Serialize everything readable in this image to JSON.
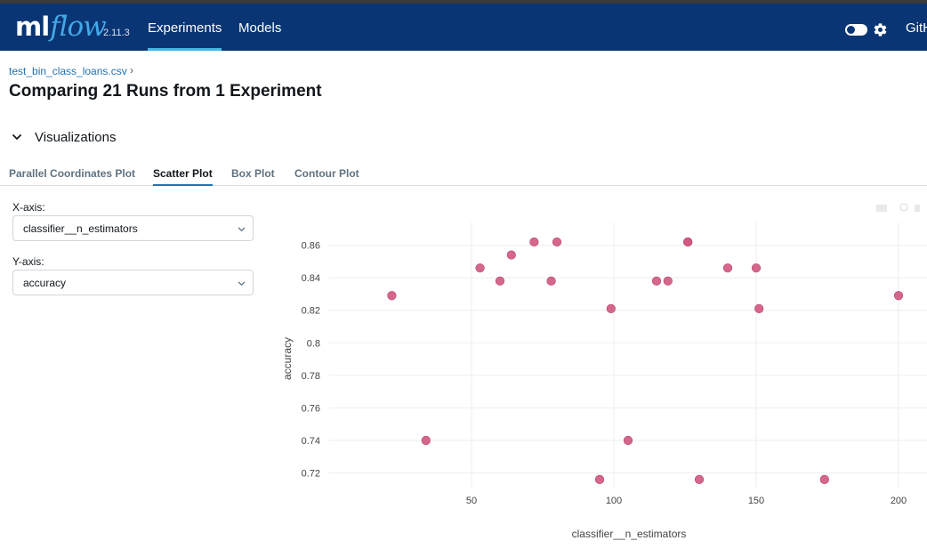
{
  "app": {
    "logo_primary": "ml",
    "logo_secondary": "flow",
    "version": "2.11.3"
  },
  "nav": {
    "items": [
      {
        "label": "Experiments",
        "active": true
      },
      {
        "label": "Models",
        "active": false
      }
    ],
    "github_label": "GitHub"
  },
  "page": {
    "breadcrumb": "test_bin_class_loans.csv",
    "breadcrumb_separator": "›",
    "title": "Comparing 21 Runs from 1 Experiment"
  },
  "visualizations": {
    "section_title": "Visualizations",
    "tabs": [
      {
        "label": "Parallel Coordinates Plot",
        "active": false
      },
      {
        "label": "Scatter Plot",
        "active": true
      },
      {
        "label": "Box Plot",
        "active": false
      },
      {
        "label": "Contour Plot",
        "active": false
      }
    ],
    "x_axis_label": "X-axis:",
    "x_axis_value": "classifier__n_estimators",
    "y_axis_label": "Y-axis:",
    "y_axis_value": "accuracy"
  },
  "colors": {
    "nav_bg": "#0a3574",
    "accent": "#2272b4",
    "point": "#d0577f"
  },
  "icons": [
    "chevron-down-icon",
    "gear-icon",
    "toggle-icon"
  ],
  "chart_data": {
    "type": "scatter",
    "title": "",
    "xlabel": "classifier__n_estimators",
    "ylabel": "accuracy",
    "xlim": [
      0,
      210
    ],
    "ylim": [
      0.711,
      0.874
    ],
    "x_ticks": [
      50,
      100,
      150,
      200
    ],
    "y_ticks": [
      0.72,
      0.74,
      0.76,
      0.78,
      0.8,
      0.82,
      0.84,
      0.86
    ],
    "y_tick_labels": [
      "0.72",
      "0.74",
      "0.76",
      "0.78",
      "0.8",
      "0.82",
      "0.84",
      "0.86"
    ],
    "grid": true,
    "points": [
      {
        "x": 22,
        "y": 0.829
      },
      {
        "x": 34,
        "y": 0.74
      },
      {
        "x": 53,
        "y": 0.846
      },
      {
        "x": 60,
        "y": 0.838
      },
      {
        "x": 64,
        "y": 0.854
      },
      {
        "x": 72,
        "y": 0.862
      },
      {
        "x": 78,
        "y": 0.838
      },
      {
        "x": 80,
        "y": 0.862
      },
      {
        "x": 95,
        "y": 0.716
      },
      {
        "x": 99,
        "y": 0.821
      },
      {
        "x": 105,
        "y": 0.74
      },
      {
        "x": 115,
        "y": 0.838
      },
      {
        "x": 119,
        "y": 0.838
      },
      {
        "x": 126,
        "y": 0.862
      },
      {
        "x": 126,
        "y": 0.862
      },
      {
        "x": 130,
        "y": 0.716
      },
      {
        "x": 140,
        "y": 0.846
      },
      {
        "x": 150,
        "y": 0.846
      },
      {
        "x": 151,
        "y": 0.821
      },
      {
        "x": 174,
        "y": 0.716
      },
      {
        "x": 200,
        "y": 0.829
      }
    ]
  }
}
